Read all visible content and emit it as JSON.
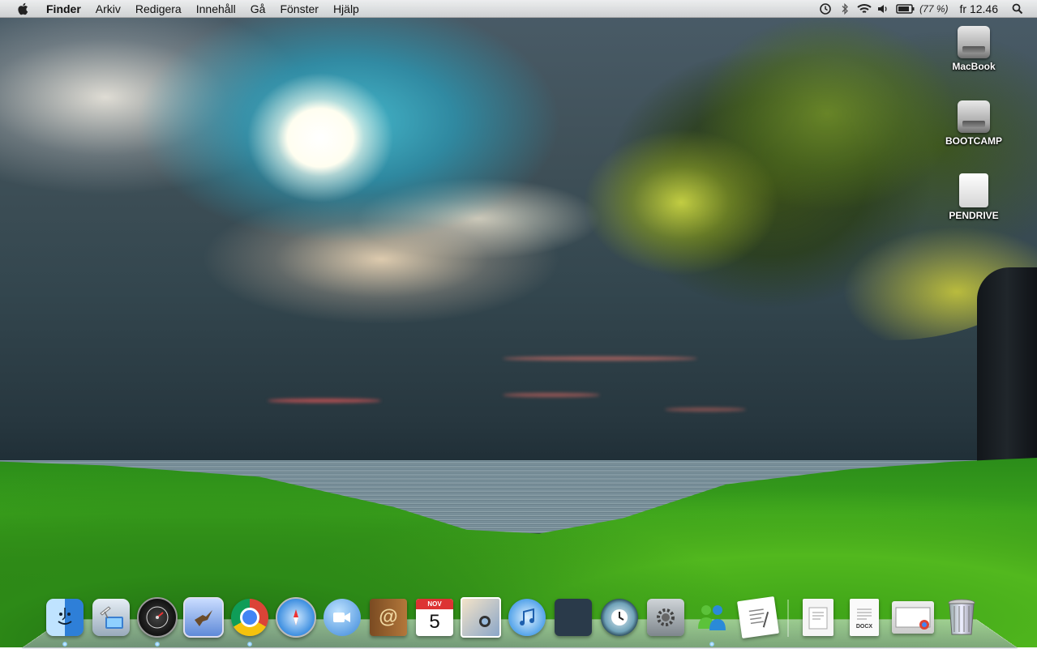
{
  "menubar": {
    "apple_icon": "apple-logo-icon",
    "app_name": "Finder",
    "menus": [
      "Arkiv",
      "Redigera",
      "Innehåll",
      "Gå",
      "Fönster",
      "Hjälp"
    ],
    "status": {
      "icons": [
        "time-machine-icon",
        "bluetooth-icon",
        "wifi-icon",
        "volume-icon",
        "battery-icon"
      ],
      "battery_percent": "(77 %)",
      "clock": "fr 12.46",
      "spotlight_icon": "spotlight-search-icon"
    }
  },
  "desktop": {
    "icons": [
      {
        "label": "MacBook",
        "type": "hard-drive"
      },
      {
        "label": "BOOTCAMP",
        "type": "hard-drive"
      },
      {
        "label": "PENDRIVE",
        "type": "usb-drive"
      }
    ]
  },
  "dock": {
    "apps": [
      "Finder",
      "Network",
      "Dashboard",
      "Mail",
      "Google Chrome",
      "Safari",
      "iChat",
      "Address Book",
      "iCal",
      "iPhoto",
      "iTunes",
      "Spaces",
      "Time Machine",
      "System Preferences",
      "MSN Messenger",
      "Preview"
    ],
    "calendar": {
      "month": "NOV",
      "day": "5"
    },
    "documents": [
      "File",
      "DOCX",
      "Chrome Window"
    ],
    "trash": "Trash"
  }
}
